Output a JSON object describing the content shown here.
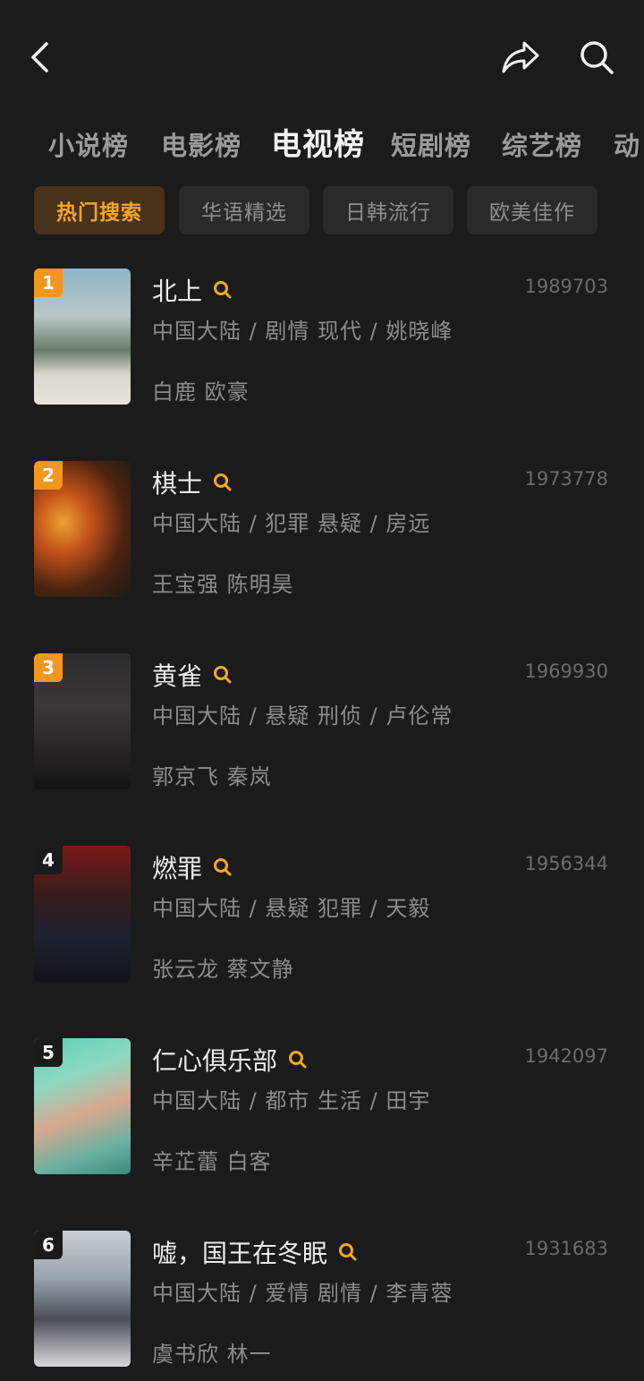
{
  "header": {
    "back_icon": "chevron-left-icon",
    "share_icon": "share-icon",
    "search_icon": "search-icon"
  },
  "tabs": [
    {
      "label": "小说榜"
    },
    {
      "label": "电影榜"
    },
    {
      "label": "电视榜",
      "active": true
    },
    {
      "label": "短剧榜"
    },
    {
      "label": "综艺榜"
    },
    {
      "label": "动"
    }
  ],
  "chips": [
    {
      "label": "热门搜索",
      "active": true
    },
    {
      "label": "华语精选"
    },
    {
      "label": "日韩流行"
    },
    {
      "label": "欧美佳作"
    }
  ],
  "colors": {
    "accent": "#f5a623",
    "rank_orange": "#f5961e",
    "rank_dark": "#1a1a1a"
  },
  "items": [
    {
      "rank": "1",
      "title": "北上",
      "score": "1989703",
      "meta": "中国大陆 / 剧情 现代 / 姚晓峰",
      "cast": "白鹿 欧豪",
      "rank_style": "orange"
    },
    {
      "rank": "2",
      "title": "棋士",
      "score": "1973778",
      "meta": "中国大陆 / 犯罪 悬疑 / 房远",
      "cast": "王宝强 陈明昊",
      "rank_style": "orange"
    },
    {
      "rank": "3",
      "title": "黄雀",
      "score": "1969930",
      "meta": "中国大陆 / 悬疑 刑侦 / 卢伦常",
      "cast": "郭京飞 秦岚",
      "rank_style": "orange"
    },
    {
      "rank": "4",
      "title": "燃罪",
      "score": "1956344",
      "meta": "中国大陆 / 悬疑 犯罪 / 天毅",
      "cast": "张云龙 蔡文静",
      "rank_style": "dark"
    },
    {
      "rank": "5",
      "title": "仁心俱乐部",
      "score": "1942097",
      "meta": "中国大陆 / 都市 生活 / 田宇",
      "cast": "辛芷蕾 白客",
      "rank_style": "dark"
    },
    {
      "rank": "6",
      "title": "嘘，国王在冬眠",
      "score": "1931683",
      "meta": "中国大陆 / 爱情 剧情 / 李青蓉",
      "cast": "虞书欣 林一",
      "rank_style": "dark"
    }
  ]
}
